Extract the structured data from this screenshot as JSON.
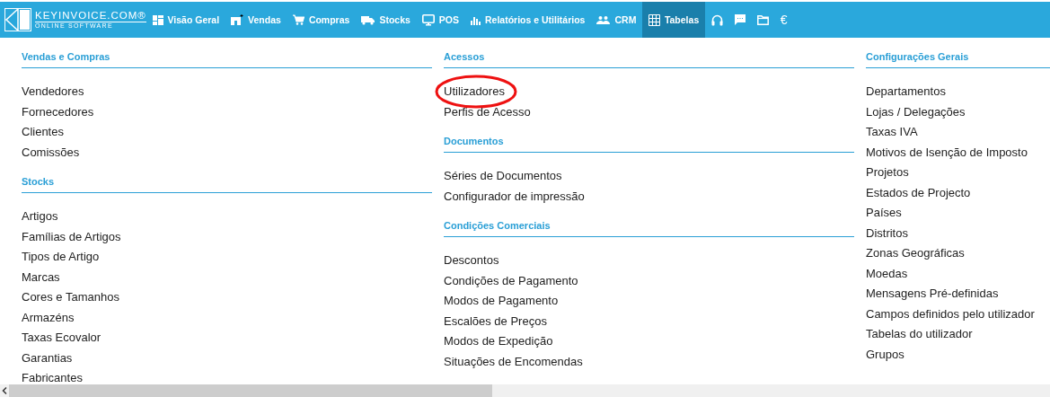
{
  "logo": {
    "name": "KEYINVOICE.COM®",
    "tagline": "ONLINE SOFTWARE"
  },
  "nav": [
    {
      "kind": "dashboard",
      "label": "Visão Geral",
      "selected": false
    },
    {
      "kind": "store",
      "label": "Vendas",
      "selected": false
    },
    {
      "kind": "cart",
      "label": "Compras",
      "selected": false
    },
    {
      "kind": "truck",
      "label": "Stocks",
      "selected": false
    },
    {
      "kind": "monitor",
      "label": "POS",
      "selected": false
    },
    {
      "kind": "bars",
      "label": "Relatórios e Utilitários",
      "selected": false
    },
    {
      "kind": "people",
      "label": "CRM",
      "selected": false
    },
    {
      "kind": "grid",
      "label": "Tabelas",
      "selected": true
    },
    {
      "kind": "headset",
      "selected": false
    },
    {
      "kind": "chat",
      "selected": false
    },
    {
      "kind": "folder",
      "selected": false
    },
    {
      "kind": "text",
      "label": "€",
      "selected": false
    }
  ],
  "columns": [
    {
      "sections": [
        {
          "title": "Vendas e Compras",
          "items": [
            {
              "label": "Vendedores",
              "circled": false
            },
            {
              "label": "Fornecedores",
              "circled": false
            },
            {
              "label": "Clientes",
              "circled": false
            },
            {
              "label": "Comissões",
              "circled": false
            }
          ]
        },
        {
          "title": "Stocks",
          "items": [
            {
              "label": "Artigos",
              "circled": false
            },
            {
              "label": "Famílias de Artigos",
              "circled": false
            },
            {
              "label": "Tipos de Artigo",
              "circled": false
            },
            {
              "label": "Marcas",
              "circled": false
            },
            {
              "label": "Cores e Tamanhos",
              "circled": false
            },
            {
              "label": "Armazéns",
              "circled": false
            },
            {
              "label": "Taxas Ecovalor",
              "circled": false
            },
            {
              "label": "Garantias",
              "circled": false
            },
            {
              "label": "Fabricantes",
              "circled": false
            }
          ]
        }
      ]
    },
    {
      "sections": [
        {
          "title": "Acessos",
          "items": [
            {
              "label": "Utilizadores",
              "circled": true
            },
            {
              "label": "Perfis de Acesso",
              "circled": false
            }
          ]
        },
        {
          "title": "Documentos",
          "items": [
            {
              "label": "Séries de Documentos",
              "circled": false
            },
            {
              "label": "Configurador de impressão",
              "circled": false
            }
          ]
        },
        {
          "title": "Condições Comerciais",
          "items": [
            {
              "label": "Descontos",
              "circled": false
            },
            {
              "label": "Condições de Pagamento",
              "circled": false
            },
            {
              "label": "Modos de Pagamento",
              "circled": false
            },
            {
              "label": "Escalões de Preços",
              "circled": false
            },
            {
              "label": "Modos de Expedição",
              "circled": false
            },
            {
              "label": "Situações de Encomendas",
              "circled": false
            }
          ]
        }
      ]
    },
    {
      "sections": [
        {
          "title": "Configurações Gerais",
          "items": [
            {
              "label": "Departamentos",
              "circled": false
            },
            {
              "label": "Lojas / Delegações",
              "circled": false
            },
            {
              "label": "Taxas IVA",
              "circled": false
            },
            {
              "label": "Motivos de Isenção de Imposto",
              "circled": false
            },
            {
              "label": "Projetos",
              "circled": false
            },
            {
              "label": "Estados de Projecto",
              "circled": false
            },
            {
              "label": "Países",
              "circled": false
            },
            {
              "label": "Distritos",
              "circled": false
            },
            {
              "label": "Zonas Geográficas",
              "circled": false
            },
            {
              "label": "Moedas",
              "circled": false
            },
            {
              "label": "Mensagens Pré-definidas",
              "circled": false
            },
            {
              "label": "Campos definidos pelo utilizador",
              "circled": false
            },
            {
              "label": "Tabelas do utilizador",
              "circled": false
            },
            {
              "label": "Grupos",
              "circled": false
            }
          ]
        }
      ]
    }
  ]
}
